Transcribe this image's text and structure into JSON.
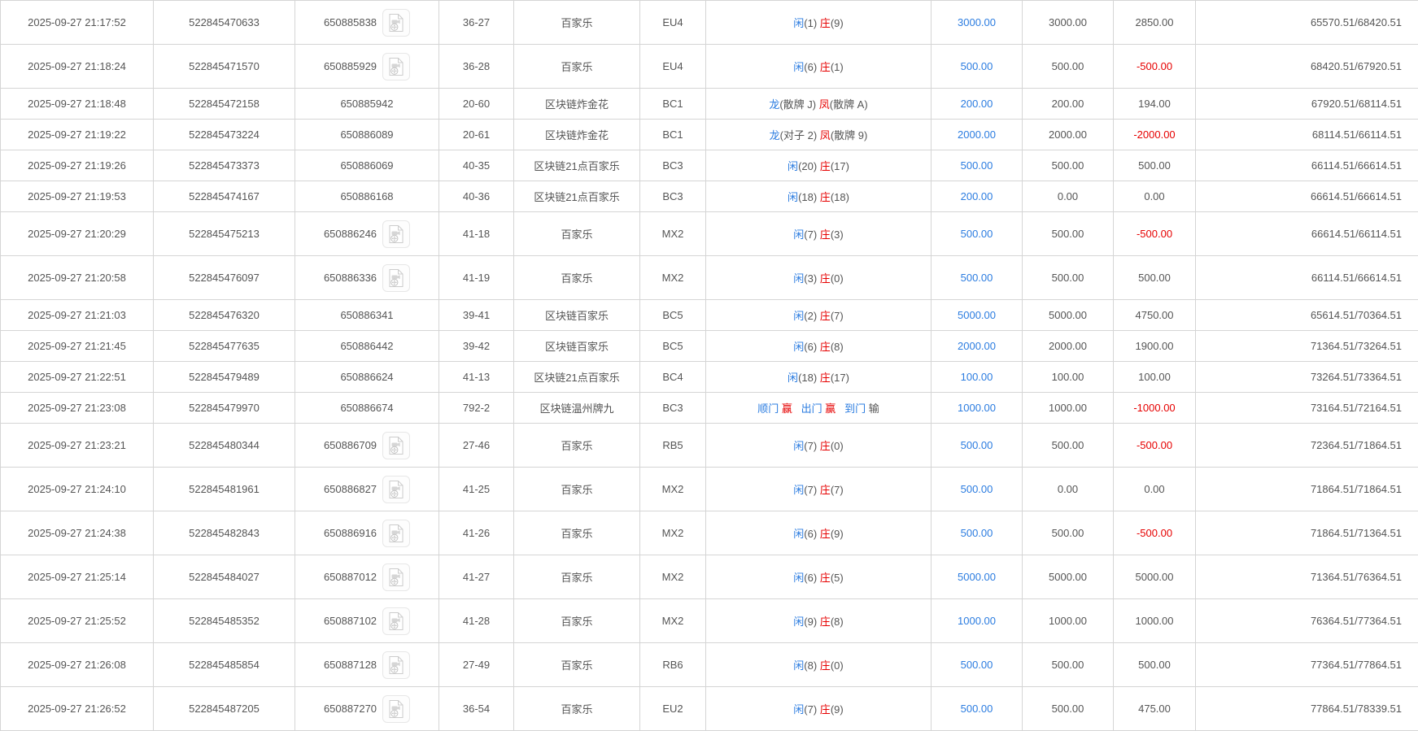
{
  "colors": {
    "blue": "#2b7ce0",
    "red": "#e60000",
    "text": "#555555",
    "border": "#d5d5d5"
  },
  "icons": {
    "video": "video-file-icon"
  },
  "table": {
    "rows": [
      {
        "time": "2025-09-27 21:17:52",
        "bet_id": "522845470633",
        "round_id": "650885838",
        "video": true,
        "round_no": "36-27",
        "game": "百家乐",
        "table_code": "EU4",
        "result": [
          {
            "t": "闲",
            "c": "blue"
          },
          {
            "t": "(1) ",
            "c": "dark"
          },
          {
            "t": "庄",
            "c": "red"
          },
          {
            "t": "(9)",
            "c": "dark"
          }
        ],
        "bet": "3000.00",
        "valid": "3000.00",
        "win_loss": "2850.00",
        "balance": "65570.51/68420.51"
      },
      {
        "time": "2025-09-27 21:18:24",
        "bet_id": "522845471570",
        "round_id": "650885929",
        "video": true,
        "round_no": "36-28",
        "game": "百家乐",
        "table_code": "EU4",
        "result": [
          {
            "t": "闲",
            "c": "blue"
          },
          {
            "t": "(6) ",
            "c": "dark"
          },
          {
            "t": "庄",
            "c": "red"
          },
          {
            "t": "(1)",
            "c": "dark"
          }
        ],
        "bet": "500.00",
        "valid": "500.00",
        "win_loss": "-500.00",
        "balance": "68420.51/67920.51"
      },
      {
        "time": "2025-09-27 21:18:48",
        "bet_id": "522845472158",
        "round_id": "650885942",
        "video": false,
        "round_no": "20-60",
        "game": "区块链炸金花",
        "table_code": "BC1",
        "result": [
          {
            "t": "龙",
            "c": "blue"
          },
          {
            "t": "(散牌 J) ",
            "c": "dark"
          },
          {
            "t": "凤",
            "c": "red"
          },
          {
            "t": "(散牌 A)",
            "c": "dark"
          }
        ],
        "bet": "200.00",
        "valid": "200.00",
        "win_loss": "194.00",
        "balance": "67920.51/68114.51"
      },
      {
        "time": "2025-09-27 21:19:22",
        "bet_id": "522845473224",
        "round_id": "650886089",
        "video": false,
        "round_no": "20-61",
        "game": "区块链炸金花",
        "table_code": "BC1",
        "result": [
          {
            "t": "龙",
            "c": "blue"
          },
          {
            "t": "(对子 2) ",
            "c": "dark"
          },
          {
            "t": "凤",
            "c": "red"
          },
          {
            "t": "(散牌 9)",
            "c": "dark"
          }
        ],
        "bet": "2000.00",
        "valid": "2000.00",
        "win_loss": "-2000.00",
        "balance": "68114.51/66114.51"
      },
      {
        "time": "2025-09-27 21:19:26",
        "bet_id": "522845473373",
        "round_id": "650886069",
        "video": false,
        "round_no": "40-35",
        "game": "区块链21点百家乐",
        "table_code": "BC3",
        "result": [
          {
            "t": "闲",
            "c": "blue"
          },
          {
            "t": "(20) ",
            "c": "dark"
          },
          {
            "t": "庄",
            "c": "red"
          },
          {
            "t": "(17)",
            "c": "dark"
          }
        ],
        "bet": "500.00",
        "valid": "500.00",
        "win_loss": "500.00",
        "balance": "66114.51/66614.51"
      },
      {
        "time": "2025-09-27 21:19:53",
        "bet_id": "522845474167",
        "round_id": "650886168",
        "video": false,
        "round_no": "40-36",
        "game": "区块链21点百家乐",
        "table_code": "BC3",
        "result": [
          {
            "t": "闲",
            "c": "blue"
          },
          {
            "t": "(18) ",
            "c": "dark"
          },
          {
            "t": "庄",
            "c": "red"
          },
          {
            "t": "(18)",
            "c": "dark"
          }
        ],
        "bet": "200.00",
        "valid": "0.00",
        "win_loss": "0.00",
        "balance": "66614.51/66614.51"
      },
      {
        "time": "2025-09-27 21:20:29",
        "bet_id": "522845475213",
        "round_id": "650886246",
        "video": true,
        "round_no": "41-18",
        "game": "百家乐",
        "table_code": "MX2",
        "result": [
          {
            "t": "闲",
            "c": "blue"
          },
          {
            "t": "(7) ",
            "c": "dark"
          },
          {
            "t": "庄",
            "c": "red"
          },
          {
            "t": "(3)",
            "c": "dark"
          }
        ],
        "bet": "500.00",
        "valid": "500.00",
        "win_loss": "-500.00",
        "balance": "66614.51/66114.51"
      },
      {
        "time": "2025-09-27 21:20:58",
        "bet_id": "522845476097",
        "round_id": "650886336",
        "video": true,
        "round_no": "41-19",
        "game": "百家乐",
        "table_code": "MX2",
        "result": [
          {
            "t": "闲",
            "c": "blue"
          },
          {
            "t": "(3) ",
            "c": "dark"
          },
          {
            "t": "庄",
            "c": "red"
          },
          {
            "t": "(0)",
            "c": "dark"
          }
        ],
        "bet": "500.00",
        "valid": "500.00",
        "win_loss": "500.00",
        "balance": "66114.51/66614.51"
      },
      {
        "time": "2025-09-27 21:21:03",
        "bet_id": "522845476320",
        "round_id": "650886341",
        "video": false,
        "round_no": "39-41",
        "game": "区块链百家乐",
        "table_code": "BC5",
        "result": [
          {
            "t": "闲",
            "c": "blue"
          },
          {
            "t": "(2) ",
            "c": "dark"
          },
          {
            "t": "庄",
            "c": "red"
          },
          {
            "t": "(7)",
            "c": "dark"
          }
        ],
        "bet": "5000.00",
        "valid": "5000.00",
        "win_loss": "4750.00",
        "balance": "65614.51/70364.51"
      },
      {
        "time": "2025-09-27 21:21:45",
        "bet_id": "522845477635",
        "round_id": "650886442",
        "video": false,
        "round_no": "39-42",
        "game": "区块链百家乐",
        "table_code": "BC5",
        "result": [
          {
            "t": "闲",
            "c": "blue"
          },
          {
            "t": "(6) ",
            "c": "dark"
          },
          {
            "t": "庄",
            "c": "red"
          },
          {
            "t": "(8)",
            "c": "dark"
          }
        ],
        "bet": "2000.00",
        "valid": "2000.00",
        "win_loss": "1900.00",
        "balance": "71364.51/73264.51"
      },
      {
        "time": "2025-09-27 21:22:51",
        "bet_id": "522845479489",
        "round_id": "650886624",
        "video": false,
        "round_no": "41-13",
        "game": "区块链21点百家乐",
        "table_code": "BC4",
        "result": [
          {
            "t": "闲",
            "c": "blue"
          },
          {
            "t": "(18) ",
            "c": "dark"
          },
          {
            "t": "庄",
            "c": "red"
          },
          {
            "t": "(17)",
            "c": "dark"
          }
        ],
        "bet": "100.00",
        "valid": "100.00",
        "win_loss": "100.00",
        "balance": "73264.51/73364.51"
      },
      {
        "time": "2025-09-27 21:23:08",
        "bet_id": "522845479970",
        "round_id": "650886674",
        "video": false,
        "round_no": "792-2",
        "game": "区块链温州牌九",
        "table_code": "BC3",
        "result": [
          {
            "t": "顺门 ",
            "c": "blue"
          },
          {
            "t": "赢",
            "c": "red"
          },
          {
            "t": "   ",
            "c": "dark"
          },
          {
            "t": "出门 ",
            "c": "blue"
          },
          {
            "t": "赢",
            "c": "red"
          },
          {
            "t": "   ",
            "c": "dark"
          },
          {
            "t": "到门 ",
            "c": "blue"
          },
          {
            "t": "输",
            "c": "dark"
          }
        ],
        "bet": "1000.00",
        "valid": "1000.00",
        "win_loss": "-1000.00",
        "balance": "73164.51/72164.51"
      },
      {
        "time": "2025-09-27 21:23:21",
        "bet_id": "522845480344",
        "round_id": "650886709",
        "video": true,
        "round_no": "27-46",
        "game": "百家乐",
        "table_code": "RB5",
        "result": [
          {
            "t": "闲",
            "c": "blue"
          },
          {
            "t": "(7) ",
            "c": "dark"
          },
          {
            "t": "庄",
            "c": "red"
          },
          {
            "t": "(0)",
            "c": "dark"
          }
        ],
        "bet": "500.00",
        "valid": "500.00",
        "win_loss": "-500.00",
        "balance": "72364.51/71864.51"
      },
      {
        "time": "2025-09-27 21:24:10",
        "bet_id": "522845481961",
        "round_id": "650886827",
        "video": true,
        "round_no": "41-25",
        "game": "百家乐",
        "table_code": "MX2",
        "result": [
          {
            "t": "闲",
            "c": "blue"
          },
          {
            "t": "(7) ",
            "c": "dark"
          },
          {
            "t": "庄",
            "c": "red"
          },
          {
            "t": "(7)",
            "c": "dark"
          }
        ],
        "bet": "500.00",
        "valid": "0.00",
        "win_loss": "0.00",
        "balance": "71864.51/71864.51"
      },
      {
        "time": "2025-09-27 21:24:38",
        "bet_id": "522845482843",
        "round_id": "650886916",
        "video": true,
        "round_no": "41-26",
        "game": "百家乐",
        "table_code": "MX2",
        "result": [
          {
            "t": "闲",
            "c": "blue"
          },
          {
            "t": "(6) ",
            "c": "dark"
          },
          {
            "t": "庄",
            "c": "red"
          },
          {
            "t": "(9)",
            "c": "dark"
          }
        ],
        "bet": "500.00",
        "valid": "500.00",
        "win_loss": "-500.00",
        "balance": "71864.51/71364.51"
      },
      {
        "time": "2025-09-27 21:25:14",
        "bet_id": "522845484027",
        "round_id": "650887012",
        "video": true,
        "round_no": "41-27",
        "game": "百家乐",
        "table_code": "MX2",
        "result": [
          {
            "t": "闲",
            "c": "blue"
          },
          {
            "t": "(6) ",
            "c": "dark"
          },
          {
            "t": "庄",
            "c": "red"
          },
          {
            "t": "(5)",
            "c": "dark"
          }
        ],
        "bet": "5000.00",
        "valid": "5000.00",
        "win_loss": "5000.00",
        "balance": "71364.51/76364.51"
      },
      {
        "time": "2025-09-27 21:25:52",
        "bet_id": "522845485352",
        "round_id": "650887102",
        "video": true,
        "round_no": "41-28",
        "game": "百家乐",
        "table_code": "MX2",
        "result": [
          {
            "t": "闲",
            "c": "blue"
          },
          {
            "t": "(9) ",
            "c": "dark"
          },
          {
            "t": "庄",
            "c": "red"
          },
          {
            "t": "(8)",
            "c": "dark"
          }
        ],
        "bet": "1000.00",
        "valid": "1000.00",
        "win_loss": "1000.00",
        "balance": "76364.51/77364.51"
      },
      {
        "time": "2025-09-27 21:26:08",
        "bet_id": "522845485854",
        "round_id": "650887128",
        "video": true,
        "round_no": "27-49",
        "game": "百家乐",
        "table_code": "RB6",
        "result": [
          {
            "t": "闲",
            "c": "blue"
          },
          {
            "t": "(8) ",
            "c": "dark"
          },
          {
            "t": "庄",
            "c": "red"
          },
          {
            "t": "(0)",
            "c": "dark"
          }
        ],
        "bet": "500.00",
        "valid": "500.00",
        "win_loss": "500.00",
        "balance": "77364.51/77864.51"
      },
      {
        "time": "2025-09-27 21:26:52",
        "bet_id": "522845487205",
        "round_id": "650887270",
        "video": true,
        "round_no": "36-54",
        "game": "百家乐",
        "table_code": "EU2",
        "result": [
          {
            "t": "闲",
            "c": "blue"
          },
          {
            "t": "(7) ",
            "c": "dark"
          },
          {
            "t": "庄",
            "c": "red"
          },
          {
            "t": "(9)",
            "c": "dark"
          }
        ],
        "bet": "500.00",
        "valid": "500.00",
        "win_loss": "475.00",
        "balance": "77864.51/78339.51"
      }
    ]
  }
}
